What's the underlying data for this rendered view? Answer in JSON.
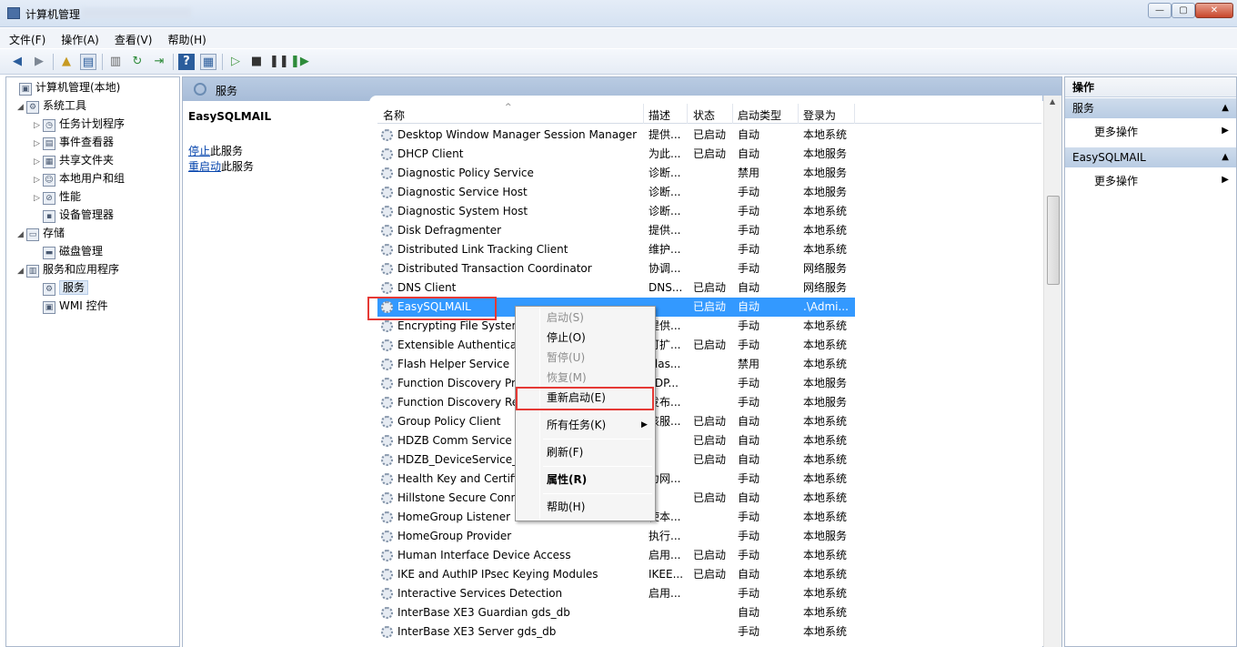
{
  "window": {
    "title": "计算机管理",
    "min": "—",
    "max": "▢",
    "close": "✕"
  },
  "menubar": [
    "文件(F)",
    "操作(A)",
    "查看(V)",
    "帮助(H)"
  ],
  "tree": [
    {
      "label": "计算机管理(本地)",
      "arrow": "",
      "icon": "computer-icon",
      "glyph": "▣",
      "level": 0
    },
    {
      "label": "系统工具",
      "arrow": "◢",
      "icon": "tools-icon",
      "glyph": "⚙",
      "level": 1
    },
    {
      "label": "任务计划程序",
      "arrow": "▷",
      "icon": "clock-icon",
      "glyph": "◷",
      "level": 2
    },
    {
      "label": "事件查看器",
      "arrow": "▷",
      "icon": "event-viewer-icon",
      "glyph": "▤",
      "level": 2
    },
    {
      "label": "共享文件夹",
      "arrow": "▷",
      "icon": "shared-folder-icon",
      "glyph": "▦",
      "level": 2
    },
    {
      "label": "本地用户和组",
      "arrow": "▷",
      "icon": "users-icon",
      "glyph": "☺",
      "level": 2
    },
    {
      "label": "性能",
      "arrow": "▷",
      "icon": "performance-icon",
      "glyph": "⊘",
      "level": 2
    },
    {
      "label": "设备管理器",
      "arrow": "",
      "icon": "device-manager-icon",
      "glyph": "▪",
      "level": 2
    },
    {
      "label": "存储",
      "arrow": "◢",
      "icon": "storage-icon",
      "glyph": "▭",
      "level": 1
    },
    {
      "label": "磁盘管理",
      "arrow": "",
      "icon": "disk-icon",
      "glyph": "▬",
      "level": 2
    },
    {
      "label": "服务和应用程序",
      "arrow": "◢",
      "icon": "services-apps-icon",
      "glyph": "▥",
      "level": 1
    },
    {
      "label": "服务",
      "arrow": "",
      "icon": "services-icon",
      "glyph": "⚙",
      "level": 2,
      "selected": true
    },
    {
      "label": "WMI 控件",
      "arrow": "",
      "icon": "wmi-icon",
      "glyph": "▣",
      "level": 2
    }
  ],
  "center": {
    "header": "服务",
    "service_title": "EasySQLMAIL",
    "stop_link": "停止",
    "stop_rest": "此服务",
    "restart_link": "重启动",
    "restart_rest": "此服务"
  },
  "columns": {
    "name": "名称",
    "desc": "描述",
    "status": "状态",
    "startup": "启动类型",
    "logon": "登录为"
  },
  "services": [
    {
      "name": "Desktop Window Manager Session Manager",
      "desc": "提供...",
      "status": "已启动",
      "startup": "自动",
      "logon": "本地系统"
    },
    {
      "name": "DHCP Client",
      "desc": "为此...",
      "status": "已启动",
      "startup": "自动",
      "logon": "本地服务"
    },
    {
      "name": "Diagnostic Policy Service",
      "desc": "诊断...",
      "status": "",
      "startup": "禁用",
      "logon": "本地服务"
    },
    {
      "name": "Diagnostic Service Host",
      "desc": "诊断...",
      "status": "",
      "startup": "手动",
      "logon": "本地服务"
    },
    {
      "name": "Diagnostic System Host",
      "desc": "诊断...",
      "status": "",
      "startup": "手动",
      "logon": "本地系统"
    },
    {
      "name": "Disk Defragmenter",
      "desc": "提供...",
      "status": "",
      "startup": "手动",
      "logon": "本地系统"
    },
    {
      "name": "Distributed Link Tracking Client",
      "desc": "维护...",
      "status": "",
      "startup": "手动",
      "logon": "本地系统"
    },
    {
      "name": "Distributed Transaction Coordinator",
      "desc": "协调...",
      "status": "",
      "startup": "手动",
      "logon": "网络服务"
    },
    {
      "name": "DNS Client",
      "desc": "DNS...",
      "status": "已启动",
      "startup": "自动",
      "logon": "网络服务"
    },
    {
      "name": "EasySQLMAIL",
      "desc": "",
      "status": "已启动",
      "startup": "自动",
      "logon": ".\\Admi...",
      "selected": true
    },
    {
      "name": "Encrypting File System",
      "desc": "提供...",
      "status": "",
      "startup": "手动",
      "logon": "本地系统"
    },
    {
      "name": "Extensible Authentication",
      "desc": "可扩...",
      "status": "已启动",
      "startup": "手动",
      "logon": "本地系统"
    },
    {
      "name": "Flash Helper Service",
      "desc": "Flas...",
      "status": "",
      "startup": "禁用",
      "logon": "本地系统"
    },
    {
      "name": "Function Discovery Pro",
      "desc": "FDP...",
      "status": "",
      "startup": "手动",
      "logon": "本地服务"
    },
    {
      "name": "Function Discovery Res",
      "desc": "发布...",
      "status": "",
      "startup": "手动",
      "logon": "本地服务"
    },
    {
      "name": "Group Policy Client",
      "desc": "该服...",
      "status": "已启动",
      "startup": "自动",
      "logon": "本地系统"
    },
    {
      "name": "HDZB Comm Service F",
      "desc": "",
      "status": "已启动",
      "startup": "自动",
      "logon": "本地系统"
    },
    {
      "name": "HDZB_DeviceService_F",
      "desc": "",
      "status": "已启动",
      "startup": "自动",
      "logon": "本地系统"
    },
    {
      "name": "Health Key and Certific",
      "desc": "为网...",
      "status": "",
      "startup": "手动",
      "logon": "本地系统"
    },
    {
      "name": "Hillstone Secure Conne",
      "desc": "",
      "status": "已启动",
      "startup": "自动",
      "logon": "本地系统"
    },
    {
      "name": "HomeGroup Listener",
      "desc": "使本...",
      "status": "",
      "startup": "手动",
      "logon": "本地系统"
    },
    {
      "name": "HomeGroup Provider",
      "desc": "执行...",
      "status": "",
      "startup": "手动",
      "logon": "本地服务"
    },
    {
      "name": "Human Interface Device Access",
      "desc": "启用...",
      "status": "已启动",
      "startup": "手动",
      "logon": "本地系统"
    },
    {
      "name": "IKE and AuthIP IPsec Keying Modules",
      "desc": "IKEE...",
      "status": "已启动",
      "startup": "自动",
      "logon": "本地系统"
    },
    {
      "name": "Interactive Services Detection",
      "desc": "启用...",
      "status": "",
      "startup": "手动",
      "logon": "本地系统"
    },
    {
      "name": "InterBase XE3 Guardian gds_db",
      "desc": "",
      "status": "",
      "startup": "自动",
      "logon": "本地系统"
    },
    {
      "name": "InterBase XE3 Server gds_db",
      "desc": "",
      "status": "",
      "startup": "手动",
      "logon": "本地系统"
    }
  ],
  "context_menu": {
    "start": "启动(S)",
    "stop": "停止(O)",
    "pause": "暂停(U)",
    "resume": "恢复(M)",
    "restart": "重新启动(E)",
    "all_tasks": "所有任务(K)",
    "refresh": "刷新(F)",
    "properties": "属性(R)",
    "help": "帮助(H)"
  },
  "actions": {
    "title": "操作",
    "section1": "服务",
    "section1_more": "更多操作",
    "section2": "EasySQLMAIL",
    "section2_more": "更多操作"
  },
  "colors": {
    "selection": "#3399ff",
    "highlight_box": "#e53935",
    "link": "#0645ad"
  }
}
